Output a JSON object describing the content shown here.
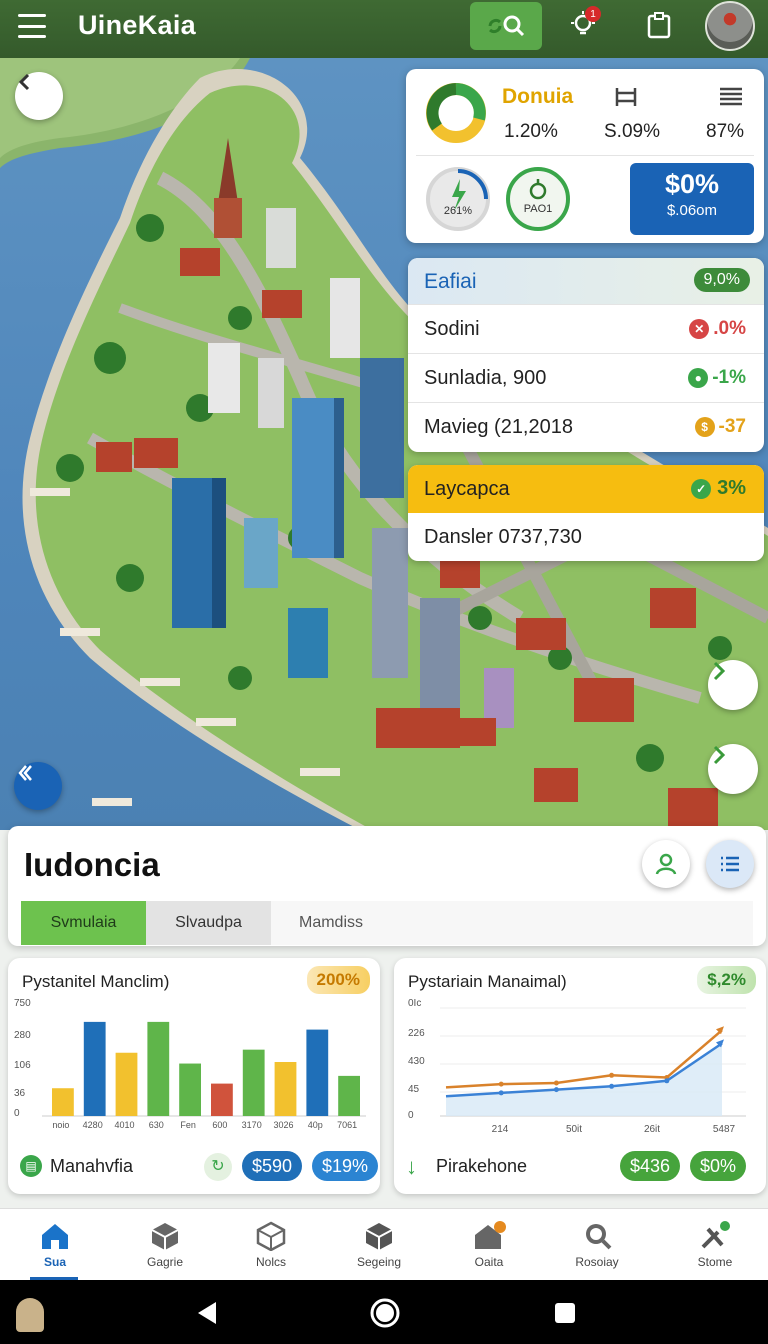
{
  "app": {
    "title": "UineKaia"
  },
  "stats": {
    "title": "Donuia",
    "donut_value": "1.20%",
    "col2_value": "S.09%",
    "col3_value": "87%",
    "gauge1_label": "261%",
    "gauge2_label": "PAO1",
    "big_value": "$0%",
    "big_sub": "$.06om"
  },
  "panel1": {
    "header": "Eafiai",
    "header_badge": "9,0%",
    "rows": [
      {
        "label": "Sodini",
        "value": ".0%",
        "color": "#d64545"
      },
      {
        "label": "Sunladia, 900",
        "value": "-1%",
        "color": "#3aa64a"
      },
      {
        "label": "Mavieg (21,2018",
        "value": "-37",
        "color": "#e3a21a"
      }
    ]
  },
  "panel2": {
    "header": "Laycapca",
    "header_badge": "3%",
    "row": "Dansler 0737,730"
  },
  "sheet": {
    "title": "Iudoncia",
    "tabs": [
      "Svmulaia",
      "Slvaudpa",
      "Mamdiss"
    ]
  },
  "chart1": {
    "title": "Pystanitel Manclim)",
    "badge": "200%",
    "footer_label": "Manahvfia",
    "pill1": "$590",
    "pill2": "$19%"
  },
  "chart2": {
    "title": "Pystariain Manaimal)",
    "badge": "$,2%",
    "footer_label": "Pirakehone",
    "pill1": "$436",
    "pill2": "$0%"
  },
  "chart_data": [
    {
      "type": "bar",
      "title": "Pystanitel Manclim)",
      "categories": [
        "noio",
        "4280",
        "4010",
        "630",
        "Fen",
        "600",
        "3170",
        "3026",
        "40p",
        "7061"
      ],
      "values": [
        1.8,
        6.1,
        4.1,
        6.1,
        3.4,
        2.1,
        4.3,
        3.5,
        5.6,
        2.6
      ],
      "colors": [
        "#f2c12e",
        "#1f6fb8",
        "#f2c12e",
        "#5fb54a",
        "#5fb54a",
        "#d0533c",
        "#5fb54a",
        "#f2c12e",
        "#1f6fb8",
        "#5fb54a"
      ],
      "yticks": [
        "750",
        "280",
        "106",
        "36",
        "0"
      ],
      "ylim": [
        0,
        7
      ]
    },
    {
      "type": "line",
      "title": "Pystariain Manaimal)",
      "xticks": [
        "214",
        "50it",
        "26it",
        "5487"
      ],
      "yticks": [
        "0Ic",
        "226",
        "430",
        "45",
        "0"
      ],
      "series": [
        {
          "x": [
            0,
            1,
            2,
            3,
            4,
            5
          ],
          "values": [
            1.3,
            1.45,
            1.5,
            1.85,
            1.75,
            3.9
          ],
          "color": "#d9822b"
        },
        {
          "x": [
            0,
            1,
            2,
            3,
            4,
            5
          ],
          "values": [
            0.9,
            1.05,
            1.2,
            1.35,
            1.6,
            3.3
          ],
          "color": "#3b82d6"
        }
      ],
      "ylim": [
        0,
        5
      ]
    }
  ],
  "nav": [
    {
      "label": "Sua",
      "icon": "home-icon"
    },
    {
      "label": "Gagrie",
      "icon": "cube-icon"
    },
    {
      "label": "Nolcs",
      "icon": "cube-icon"
    },
    {
      "label": "Segeing",
      "icon": "cube-icon"
    },
    {
      "label": "Oaita",
      "icon": "house-icon"
    },
    {
      "label": "Rosoiay",
      "icon": "search-icon"
    },
    {
      "label": "Stome",
      "icon": "tools-icon"
    }
  ],
  "colors": {
    "brand": "#3f6a33",
    "accent_green": "#5fb54a",
    "accent_blue": "#1f6fb8",
    "accent_yellow": "#f2c12e"
  }
}
